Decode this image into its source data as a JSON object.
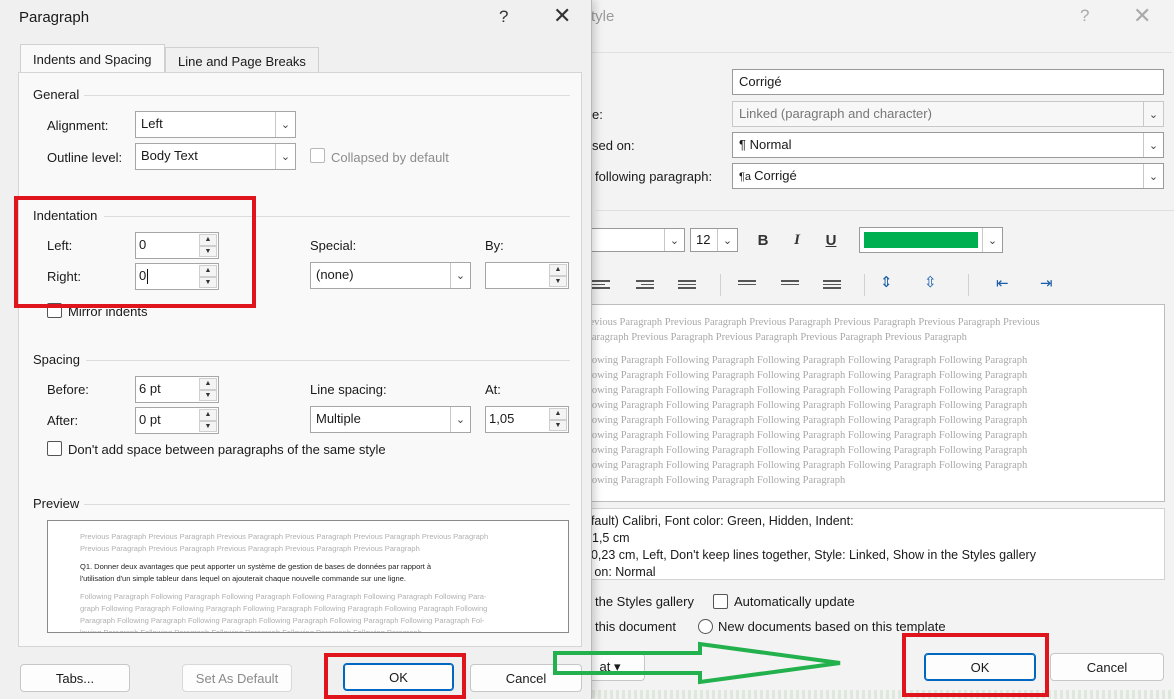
{
  "background_dialog": {
    "title_fragment": "tyle",
    "help": "?",
    "close": "✕",
    "name_value": "Corrigé",
    "style_type_label_fragment": "e:",
    "style_type_value": "Linked (paragraph and character)",
    "based_on_label_fragment": "sed on:",
    "based_on_value": "Normal",
    "following_label_fragment": "following paragraph:",
    "following_value": "Corrigé",
    "font_size": "12",
    "bold": "B",
    "italic": "I",
    "underline": "U",
    "font_color": "#00b050",
    "preview_previous": [
      "revious Paragraph Previous Paragraph Previous Paragraph Previous Paragraph Previous Paragraph Previous",
      "Paragraph Previous Paragraph Previous Paragraph Previous Paragraph Previous Paragraph"
    ],
    "preview_following": [
      "llowing Paragraph Following Paragraph Following Paragraph Following Paragraph Following Paragraph",
      "llowing Paragraph Following Paragraph Following Paragraph Following Paragraph Following Paragraph",
      "llowing Paragraph Following Paragraph Following Paragraph Following Paragraph Following Paragraph",
      "llowing Paragraph Following Paragraph Following Paragraph Following Paragraph Following Paragraph",
      "llowing Paragraph Following Paragraph Following Paragraph Following Paragraph Following Paragraph",
      "llowing Paragraph Following Paragraph Following Paragraph Following Paragraph Following Paragraph",
      "llowing Paragraph Following Paragraph Following Paragraph Following Paragraph Following Paragraph",
      "llowing Paragraph Following Paragraph Following Paragraph Following Paragraph Following Paragraph",
      "llowing Paragraph Following Paragraph Following Paragraph"
    ],
    "description": [
      "efault) Calibri, Font color: Green, Hidden, Indent:",
      "1,5 cm",
      ":  0,23 cm, Left, Don't keep lines together, Style: Linked, Show in the Styles gallery",
      "d on: Normal"
    ],
    "add_gallery_fragment": "the Styles gallery",
    "auto_update": "Automatically update",
    "only_doc_fragment": "this document",
    "new_docs": "New documents based on this template",
    "format_fragment": "at ▾",
    "ok": "OK",
    "cancel": "Cancel"
  },
  "paragraph_dialog": {
    "title": "Paragraph",
    "help": "?",
    "close": "✕",
    "tabs": [
      "Indents and Spacing",
      "Line and Page Breaks"
    ],
    "general": {
      "heading": "General",
      "alignment_label": "Alignment:",
      "alignment_value": "Left",
      "outline_label": "Outline level:",
      "outline_value": "Body Text",
      "collapsed_label": "Collapsed by default"
    },
    "indentation": {
      "heading": "Indentation",
      "left_label": "Left:",
      "left_value": "0",
      "right_label": "Right:",
      "right_value": "0",
      "special_label": "Special:",
      "special_value": "(none)",
      "by_label": "By:",
      "by_value": "",
      "mirror_label": "Mirror indents"
    },
    "spacing": {
      "heading": "Spacing",
      "before_label": "Before:",
      "before_value": "6 pt",
      "after_label": "After:",
      "after_value": "0 pt",
      "line_spacing_label": "Line spacing:",
      "line_spacing_value": "Multiple",
      "at_label": "At:",
      "at_value": "1,05",
      "dont_add_label": "Don't add space between paragraphs of the same style"
    },
    "preview": {
      "heading": "Preview",
      "previous": [
        "Previous Paragraph Previous Paragraph Previous Paragraph Previous Paragraph Previous Paragraph Previous Paragraph",
        "Previous Paragraph Previous Paragraph Previous Paragraph Previous Paragraph Previous Paragraph"
      ],
      "current": [
        "Q1.        Donner deux avantages que peut apporter un système de gestion de bases de données par rapport à",
        "l'utilisation d'un simple tableur dans lequel on ajouterait chaque nouvelle commande sur une ligne."
      ],
      "following": [
        "Following Paragraph Following Paragraph Following Paragraph Following Paragraph Following Paragraph Following Para-",
        "graph Following Paragraph Following Paragraph Following Paragraph Following Paragraph Following Paragraph Following",
        "Paragraph Following Paragraph Following Paragraph Following Paragraph Following Paragraph Following Paragraph Fol-",
        "lowing Paragraph Following Paragraph Following Paragraph Following Paragraph Following Paragraph"
      ]
    },
    "buttons": {
      "tabs": "Tabs...",
      "set_default": "Set As Default",
      "ok": "OK",
      "cancel": "Cancel"
    }
  },
  "annotation_colors": {
    "red_box": "#e0141d",
    "green_arrow": "#22b14c"
  }
}
